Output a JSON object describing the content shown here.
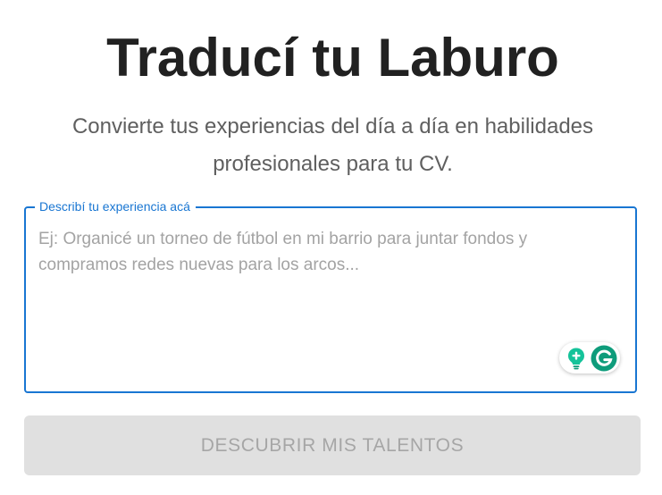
{
  "header": {
    "title": "Traducí tu Laburo",
    "subtitle": "Convierte tus experiencias del día a día en habilidades profesionales para tu CV."
  },
  "experience_field": {
    "label": "Describí tu experiencia acá",
    "value": "",
    "placeholder": "Ej: Organicé un torneo de fútbol en mi barrio para juntar fondos y compramos redes nuevas para los arcos...",
    "accent_color": "#1976d2"
  },
  "grammarly_widget": {
    "icons": [
      "lightbulb-plus-icon",
      "grammarly-g-icon"
    ],
    "brand_color": "#15c39a"
  },
  "submit_button": {
    "label": "DESCUBRIR MIS TALENTOS",
    "disabled": true
  }
}
